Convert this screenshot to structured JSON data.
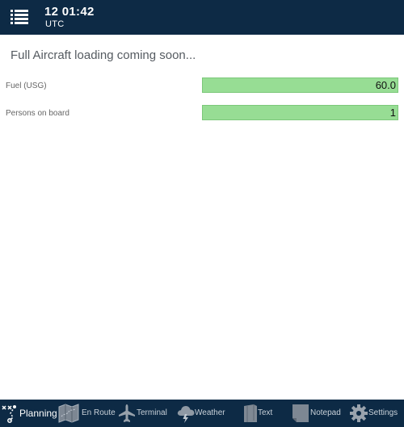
{
  "header": {
    "time": "12 01:42",
    "zone": "UTC",
    "menu_icon": "list-menu-icon",
    "background": "#0d2a45"
  },
  "main": {
    "message": "Full Aircraft loading coming soon...",
    "fields": [
      {
        "label": "Fuel (USG)",
        "value": "60.0"
      },
      {
        "label": "Persons on board",
        "value": "1"
      }
    ],
    "field_color": "#97dd94"
  },
  "tabs": [
    {
      "label": "Planning",
      "icon": "route-planning-icon",
      "active": true
    },
    {
      "label": "En Route",
      "icon": "map-icon",
      "active": false
    },
    {
      "label": "Terminal",
      "icon": "airplane-icon",
      "active": false
    },
    {
      "label": "Weather",
      "icon": "cloud-lightning-icon",
      "active": false
    },
    {
      "label": "Text",
      "icon": "document-icon",
      "active": false
    },
    {
      "label": "Notepad",
      "icon": "notepad-icon",
      "active": false
    },
    {
      "label": "Settings",
      "icon": "gear-icon",
      "active": false
    }
  ]
}
